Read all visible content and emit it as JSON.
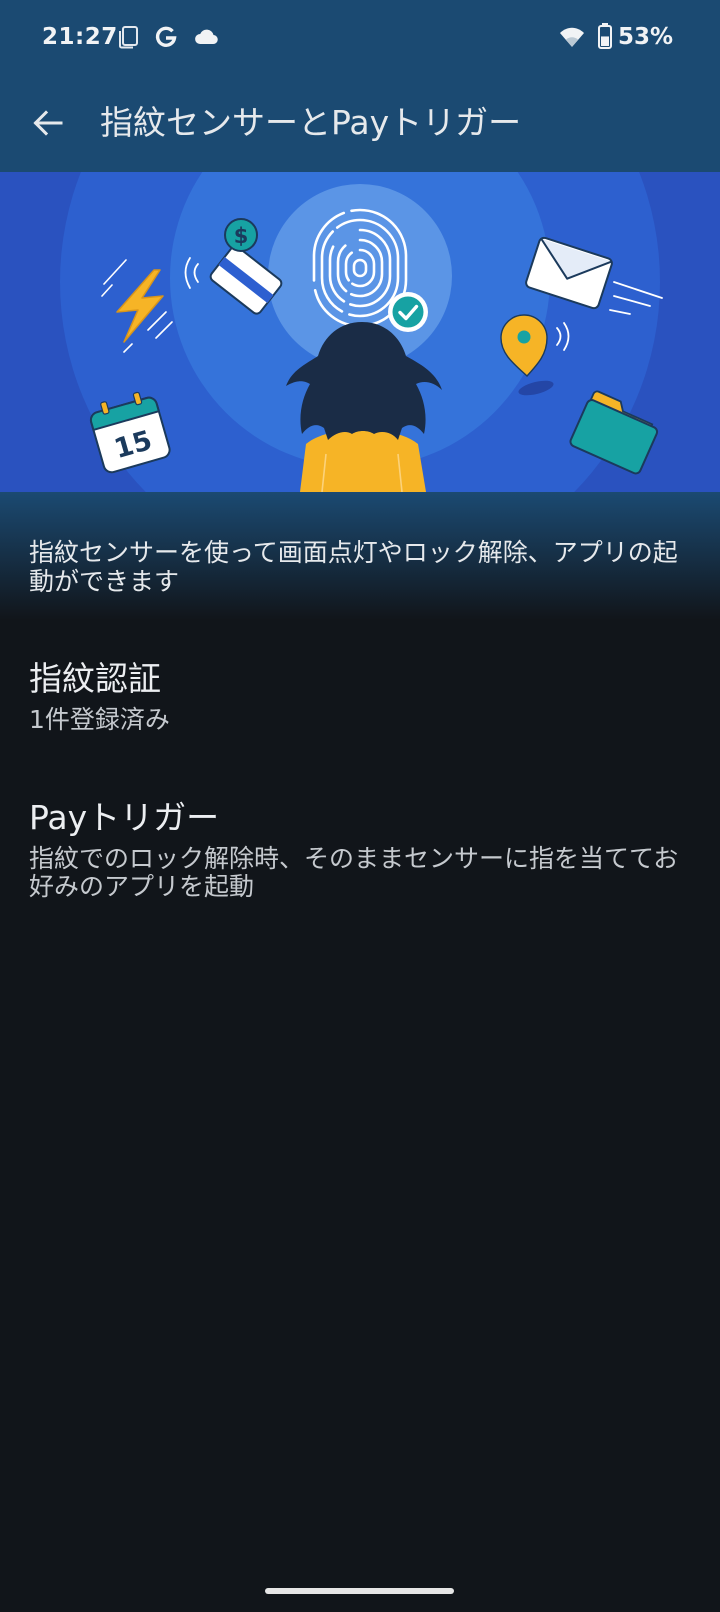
{
  "status_bar": {
    "time": "21:27",
    "battery_percent": "53%",
    "battery_level": 0.53,
    "notification_icons": [
      "screenshot-icon",
      "google-icon",
      "cloud-icon"
    ],
    "system_icons": [
      "wifi-icon",
      "battery-icon"
    ]
  },
  "app_bar": {
    "back_icon": "arrow-left-icon",
    "title": "指紋センサーとPayトリガー"
  },
  "illustration": {
    "calendar_day": "15",
    "coin_symbol": "$",
    "icons": [
      "fingerprint-icon",
      "check-badge-icon",
      "lightning-icon",
      "calendar-icon",
      "credit-card-icon",
      "coin-icon",
      "envelope-icon",
      "location-pin-icon",
      "folder-icon"
    ]
  },
  "description": "指紋センサーを使って画面点灯やロック解除、アプリの起動ができます",
  "settings": [
    {
      "title": "指紋認証",
      "summary": "1件登録済み"
    },
    {
      "title": "Payトリガー",
      "summary": "指紋でのロック解除時、そのままセンサーに指を当ててお好みのアプリを起動"
    }
  ],
  "colors": {
    "app_bar": "#1b4a72",
    "background": "#11151a",
    "illustration_bg": "#2a52bf",
    "accent_yellow": "#f6b426",
    "accent_teal": "#17a2a3",
    "text_primary": "#eceef1",
    "text_secondary": "#c5c9ce"
  }
}
